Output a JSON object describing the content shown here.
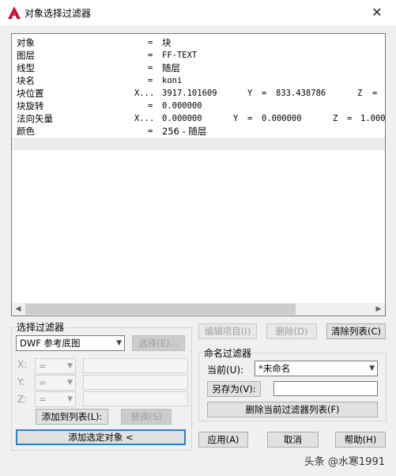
{
  "window": {
    "title": "对象选择过滤器",
    "close_glyph": "✕"
  },
  "filter_list": {
    "rows": [
      {
        "name": "对象",
        "op": "=",
        "value": "块"
      },
      {
        "name": "图层",
        "op": "=",
        "value": "FF-TEXT"
      },
      {
        "name": "线型",
        "op": "=",
        "value": "随层"
      },
      {
        "name": "块名",
        "op": "=",
        "value": "koni"
      },
      {
        "name": "块位置",
        "op": "X...",
        "value": "3917.101609",
        "y_label": "Y",
        "y_op": "=",
        "y_value": "833.438786",
        "z_label": "Z",
        "z_op": "="
      },
      {
        "name": "块旋转",
        "op": "=",
        "value": "0.000000"
      },
      {
        "name": "法向矢量",
        "op": "X...",
        "value": "0.000000",
        "y_label": "Y",
        "y_op": "=",
        "y_value": "0.000000",
        "z_label": "Z",
        "z_op": "=",
        "z_value": "1.000"
      },
      {
        "name": "颜色",
        "op": "=",
        "value": "256 - 随层"
      }
    ]
  },
  "select_filter": {
    "title": "选择过滤器",
    "type_value": "DWF 参考底图",
    "select_button": "选择(E)...",
    "x_label": "X:",
    "y_label": "Y:",
    "z_label": "Z:",
    "op_value": "=",
    "add_to_list": "添加到列表(L):",
    "replace": "替换(S)",
    "add_selected": "添加选定对象 <"
  },
  "list_buttons": {
    "edit": "编辑项目(I)",
    "delete": "删除(D)",
    "clear": "清除列表(C)"
  },
  "named_filters": {
    "title": "命名过滤器",
    "current_label": "当前(U):",
    "current_value": "*未命名",
    "save_as": "另存为(V):",
    "save_as_value": "",
    "delete_current": "删除当前过滤器列表(F)"
  },
  "footer": {
    "apply": "应用(A)",
    "cancel": "取消",
    "help": "帮助(H)"
  },
  "watermark": "头条 @水寒1991",
  "colors": {
    "accent": "#2d7fd6",
    "app_icon": "#c8102e"
  }
}
